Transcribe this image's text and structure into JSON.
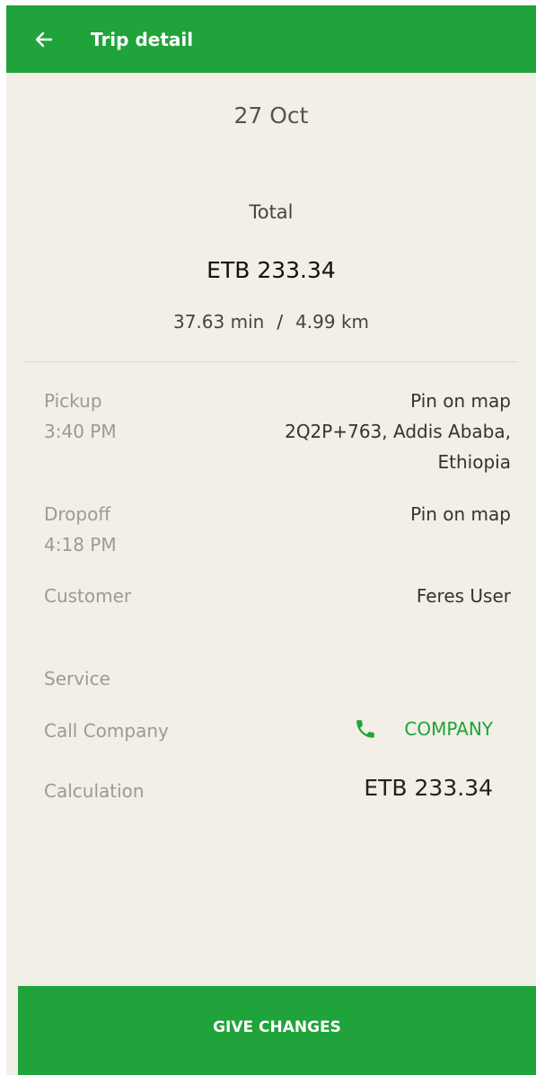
{
  "app_bar": {
    "title": "Trip detail",
    "back_icon": "arrow-left-icon"
  },
  "summary": {
    "date": "27 Oct",
    "total_label": "Total",
    "total_amount": "ETB 233.34",
    "duration": "37.63 min",
    "separator": "/",
    "distance": "4.99 km"
  },
  "details": {
    "pickup": {
      "label": "Pickup",
      "time": "3:40 PM",
      "location_title": "Pin on map",
      "address_line1": "2Q2P+763, Addis Ababa,",
      "address_line2": "Ethiopia"
    },
    "dropoff": {
      "label": "Dropoff",
      "time": "4:18 PM",
      "location_title": "Pin on map"
    },
    "customer": {
      "label": "Customer",
      "value": "Feres User"
    },
    "service": {
      "label": "Service"
    },
    "call_company": {
      "label": "Call Company",
      "button_label": "COMPANY",
      "icon": "phone-icon"
    },
    "calculation": {
      "label": "Calculation",
      "value": "ETB 233.34"
    }
  },
  "footer": {
    "button_label": "GIVE CHANGES"
  },
  "colors": {
    "primary": "#1fa33a",
    "background": "#f1efe6",
    "label_gray": "#9c9a92"
  }
}
